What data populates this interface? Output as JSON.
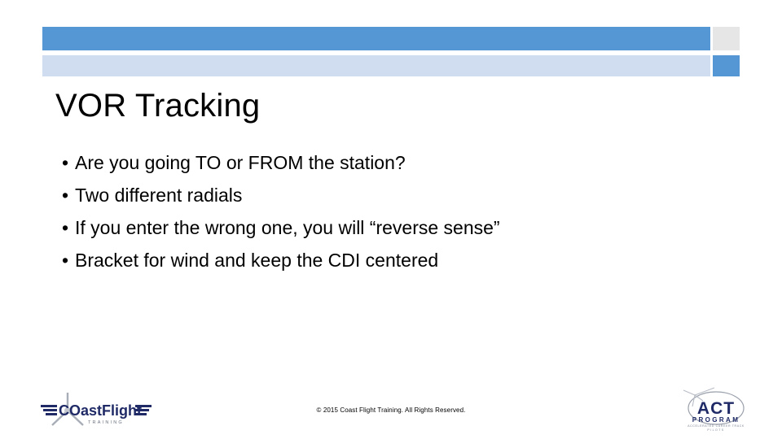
{
  "slide": {
    "title": "VOR Tracking",
    "bullet_char": "•",
    "bullets": [
      "Are you going TO or FROM the station?",
      "Two different radials",
      "If you enter the wrong one, you will “reverse sense”",
      "Bracket for wind and keep the CDI centered"
    ],
    "footer": "© 2015 Coast Flight Training. All Rights Reserved."
  },
  "decor": {
    "bar_blue": "#5596d4",
    "bar_light_blue": "#d0dcef",
    "bar_gray": "#e6e6e6"
  },
  "logo_left": {
    "name": "coast-flight-logo",
    "wordmark_coast": "COast",
    "wordmark_flight": "Flight",
    "tagline": "T R A I N I N G",
    "color": "#1f2a66"
  },
  "logo_right": {
    "name": "act-program-logo",
    "wordmark": "ACT",
    "subtitle": "PROGRAM",
    "tagline_line_1": "ACCELERATED CAREER TRACK",
    "tagline_line_2": "PILOTS",
    "color": "#1f2a66"
  }
}
